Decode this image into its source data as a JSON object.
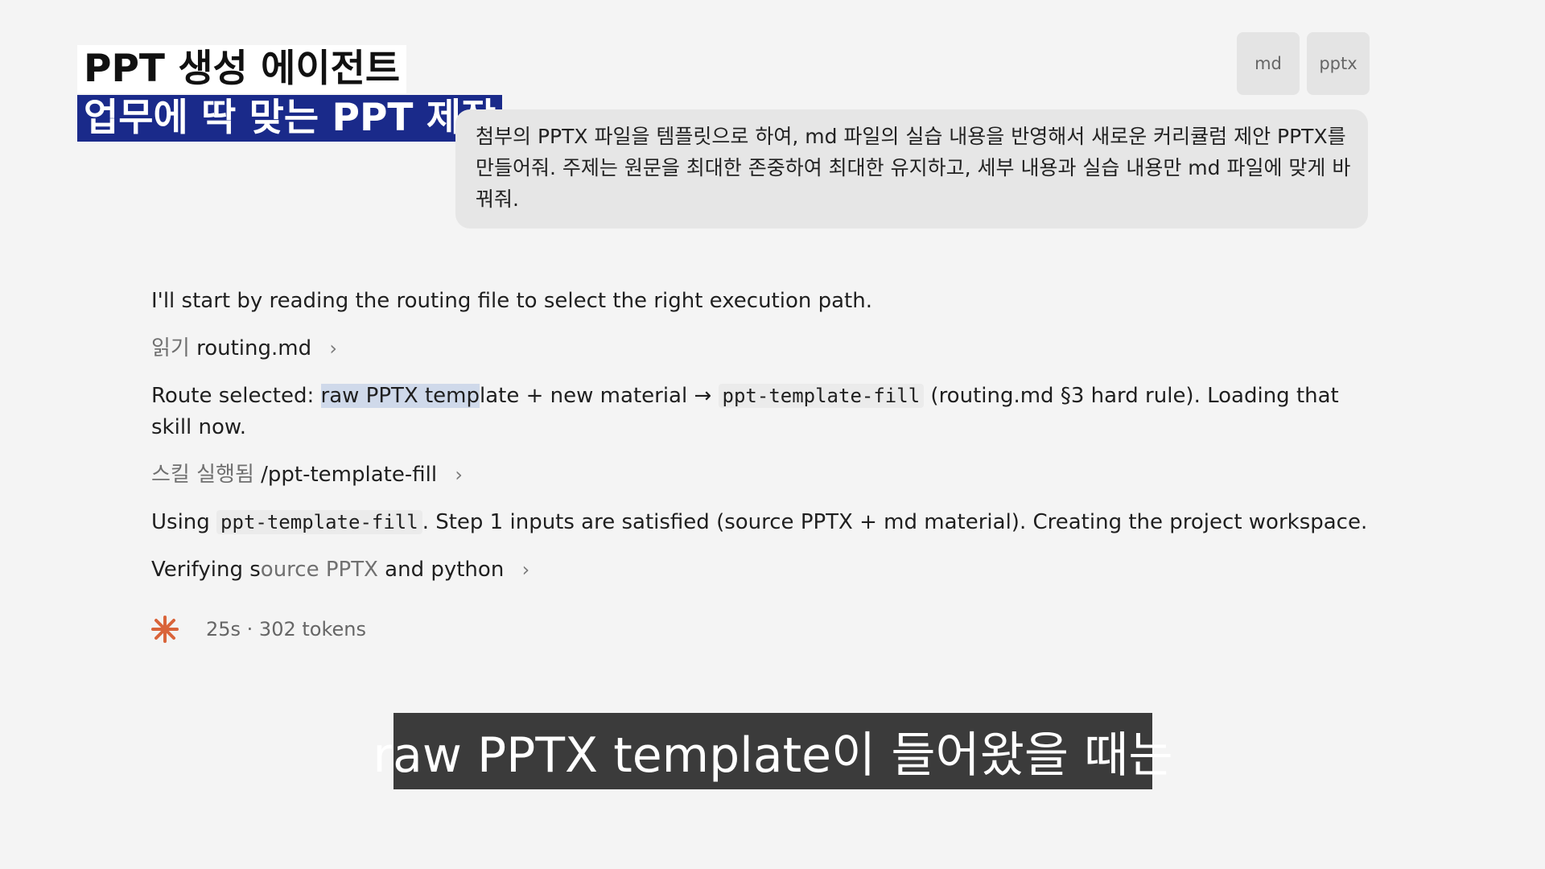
{
  "overlay": {
    "title": "PPT 생성 에이전트",
    "subtitle": "업무에 딱 맞는 PPT 제작"
  },
  "attachments": [
    {
      "label": "md"
    },
    {
      "label": "pptx"
    }
  ],
  "user_message": "첨부의 PPTX 파일을 템플릿으로 하여, md 파일의 실습 내용을 반영해서 새로운 커리큘럼 제안 PPTX를 만들어줘. 주제는 원문을 최대한 존중하여 최대한 유지하고, 세부 내용과 실습 내용만 md 파일에 맞게 바꿔줘.",
  "assistant": {
    "intro": "I'll start by reading the routing file to select the right execution path.",
    "read_action": {
      "prefix": "읽기",
      "target": "routing.md"
    },
    "route": {
      "prefix": "Route selected: ",
      "highlight": "raw PPTX temp",
      "rest": "late + new material → ",
      "code": "ppt-template-fill",
      "suffix": " (routing.md §3 hard rule). Loading that",
      "line2": "skill now."
    },
    "skill_action": {
      "prefix": "스킬 실행됨",
      "target": "/ppt-template-fill"
    },
    "using": {
      "prefix": "Using ",
      "code": "ppt-template-fill",
      "suffix": ". Step 1 inputs are satisfied (source PPTX + md material). Creating the project workspace."
    },
    "verifying": {
      "a": "Verifying s",
      "b": "ource PPTX",
      "c": " and python"
    },
    "status": "25s · 302 tokens"
  },
  "caption": "raw PPTX template이 들어왔을 때는",
  "colors": {
    "spark": "#d9643a",
    "title_bg": "#1a2a8a",
    "caption_bg": "#3b3b3b"
  }
}
